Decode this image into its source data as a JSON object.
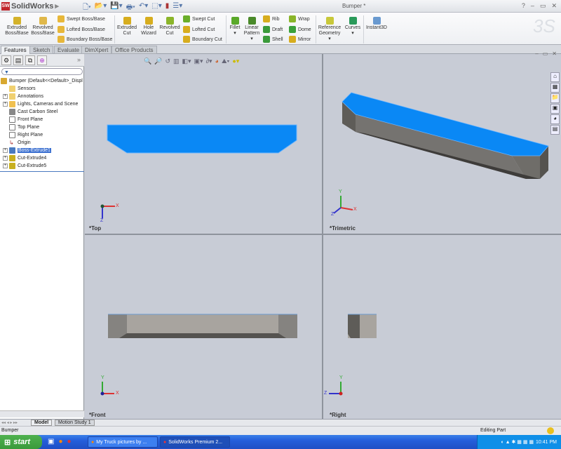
{
  "app": {
    "name": "SolidWorks",
    "doc_title": "Bumper *",
    "help": "?",
    "min": "–",
    "restore": "▭",
    "close": "✕"
  },
  "ribbon": {
    "extruded_boss": "Extruded Boss/Base",
    "revolved_boss": "Revolved Boss/Base",
    "swept_boss": "Swept Boss/Base",
    "lofted_boss": "Lofted Boss/Base",
    "boundary_boss": "Boundary Boss/Base",
    "extruded_cut": "Extruded Cut",
    "hole_wizard": "Hole Wizard",
    "revolved_cut": "Revolved Cut",
    "swept_cut": "Swept Cut",
    "lofted_cut": "Lofted Cut",
    "boundary_cut": "Boundary Cut",
    "fillet": "Fillet",
    "linear_pattern": "Linear Pattern",
    "rib": "Rib",
    "draft": "Draft",
    "shell": "Shell",
    "wrap": "Wrap",
    "dome": "Dome",
    "mirror": "Mirror",
    "reference_geometry": "Reference Geometry",
    "curves": "Curves",
    "instant3d": "Instant3D"
  },
  "tabs": [
    "Features",
    "Sketch",
    "Evaluate",
    "DimXpert",
    "Office Products"
  ],
  "tree": {
    "root": "Bumper  (Default<<Default>_Displ",
    "items": [
      "Sensors",
      "Annotations",
      "Lights, Cameras and Scene",
      "Cast Carbon Steel",
      "Front Plane",
      "Top Plane",
      "Right Plane",
      "Origin",
      "Boss-Extrude1",
      "Cut-Extrude4",
      "Cut-Extrude5"
    ]
  },
  "views": {
    "top": "*Top",
    "trimetric": "*Trimetric",
    "front": "*Front",
    "right": "*Right"
  },
  "axes": {
    "x": "X",
    "y": "Y",
    "z": "Z"
  },
  "bottom_tabs": [
    "Model",
    "Motion Study 1"
  ],
  "status": {
    "left": "Bumper",
    "mode": "Editing Part"
  },
  "taskbar": {
    "start": "start",
    "tasks": [
      "My Truck pictures by ...",
      "SolidWorks Premium 2..."
    ],
    "clock": "10:41 PM"
  },
  "colors": {
    "face_blue": "#0a88f5",
    "body_gray": "#7a7873"
  }
}
